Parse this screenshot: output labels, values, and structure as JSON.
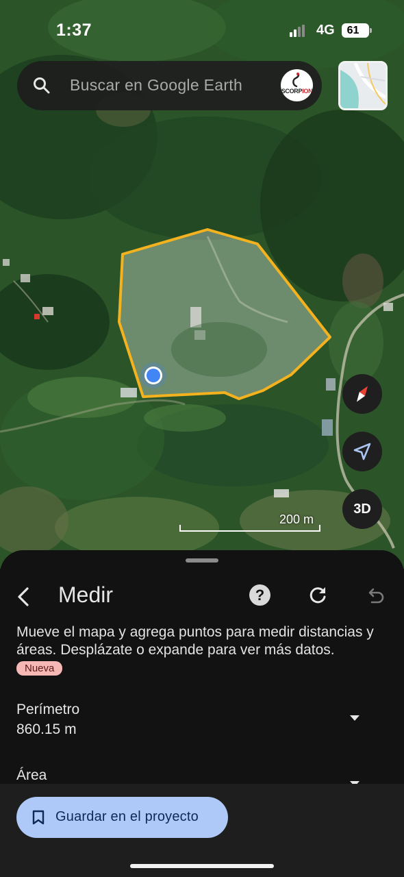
{
  "status_bar": {
    "time": "1:37",
    "network": "4G",
    "battery": "61"
  },
  "search": {
    "placeholder": "Buscar en Google Earth",
    "avatar_text_a": "SCORP",
    "avatar_text_b": "ION"
  },
  "map": {
    "scale_label": "200 m",
    "polygon_color": "#f4b21f",
    "location_dot_color": "#4285f4",
    "buttons": {
      "three_d": "3D"
    }
  },
  "sheet": {
    "title": "Medir",
    "description": "Mueve el mapa y agrega puntos para medir distancias y áreas. Desplázate o expande para ver más datos.",
    "badge": "Nueva",
    "perimeter_label": "Perímetro",
    "perimeter_value": "860.15 m",
    "area_label": "Área",
    "save_label": "Guardar en el proyecto"
  },
  "colors": {
    "accent_button": "#aec8f7",
    "badge_bg": "#f5b8b5",
    "sheet_bg": "#121212"
  }
}
